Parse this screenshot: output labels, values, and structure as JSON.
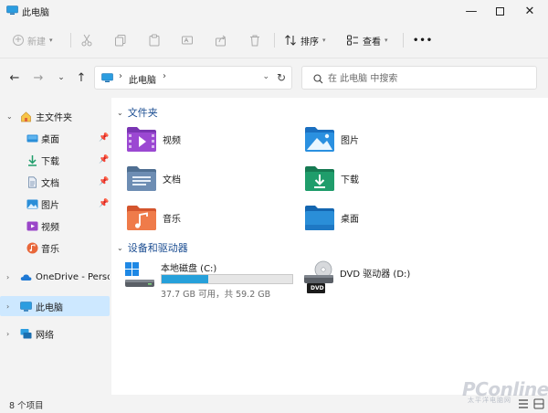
{
  "window": {
    "title": "此电脑",
    "minimize_icon": "minimize-icon",
    "maximize_icon": "maximize-icon",
    "close_icon": "close-icon"
  },
  "toolbar": {
    "new_label": "新建",
    "sort_label": "排序",
    "view_label": "查看",
    "more_label": "•••"
  },
  "address": {
    "crumb": "此电脑",
    "separator": "›"
  },
  "search": {
    "placeholder": "在 此电脑 中搜索"
  },
  "sidebar": {
    "items": [
      {
        "label": "主文件夹",
        "icon": "home-icon",
        "expander": "⌄"
      },
      {
        "label": "桌面",
        "icon": "desktop-folder-icon",
        "pinned": true
      },
      {
        "label": "下载",
        "icon": "downloads-icon",
        "pinned": true
      },
      {
        "label": "文档",
        "icon": "documents-icon",
        "pinned": true
      },
      {
        "label": "图片",
        "icon": "pictures-icon",
        "pinned": true
      },
      {
        "label": "视频",
        "icon": "videos-icon"
      },
      {
        "label": "音乐",
        "icon": "music-icon"
      },
      {
        "label": "OneDrive - Persor",
        "icon": "onedrive-cloud-icon",
        "expander": "›"
      },
      {
        "label": "此电脑",
        "icon": "this-pc-icon",
        "expander": "›",
        "selected": true
      },
      {
        "label": "网络",
        "icon": "network-icon",
        "expander": "›"
      }
    ]
  },
  "content": {
    "folders_group": "文件夹",
    "folders": [
      {
        "label": "视频",
        "icon": "videos-folder-icon"
      },
      {
        "label": "图片",
        "icon": "pictures-folder-icon"
      },
      {
        "label": "文档",
        "icon": "documents-folder-icon"
      },
      {
        "label": "下载",
        "icon": "downloads-folder-icon"
      },
      {
        "label": "音乐",
        "icon": "music-folder-icon"
      },
      {
        "label": "桌面",
        "icon": "desktop-folder-icon"
      }
    ],
    "devices_group": "设备和驱动器",
    "drives": [
      {
        "label": "本地磁盘 (C:)",
        "usage": "37.7 GB 可用，共 59.2 GB",
        "used_fraction": 0.36,
        "icon": "windows-drive-icon"
      },
      {
        "label": "DVD 驱动器 (D:)",
        "icon": "dvd-drive-icon",
        "badge": "DVD"
      }
    ]
  },
  "status": {
    "count": "8 个项目"
  },
  "watermark": {
    "text": "PConline",
    "sub": "太平洋电脑网"
  },
  "colors": {
    "accent": "#26a0da",
    "selected": "#cde8ff",
    "group_heading": "#1a4c91"
  }
}
